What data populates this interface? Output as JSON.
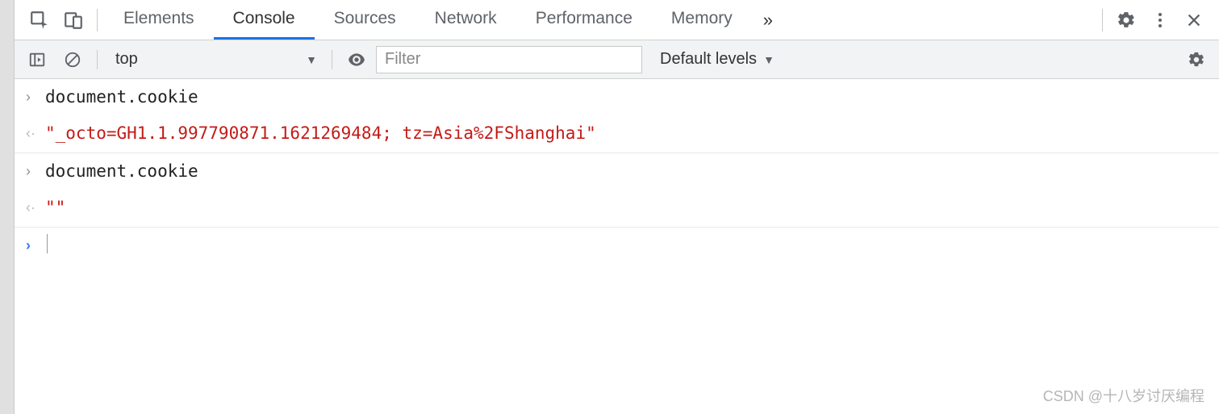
{
  "tabs": {
    "items": [
      "Elements",
      "Console",
      "Sources",
      "Network",
      "Performance",
      "Memory"
    ],
    "active_index": 1
  },
  "toolbar": {
    "context": "top",
    "filter_placeholder": "Filter",
    "levels": "Default levels"
  },
  "console": {
    "entries": [
      {
        "type": "input",
        "text": "document.cookie"
      },
      {
        "type": "output",
        "kind": "string",
        "text": "\"_octo=GH1.1.997790871.1621269484; tz=Asia%2FShanghai\""
      },
      {
        "type": "input",
        "text": "document.cookie"
      },
      {
        "type": "output",
        "kind": "string",
        "text": "\"\""
      }
    ]
  },
  "watermark": "CSDN @十八岁讨厌编程"
}
